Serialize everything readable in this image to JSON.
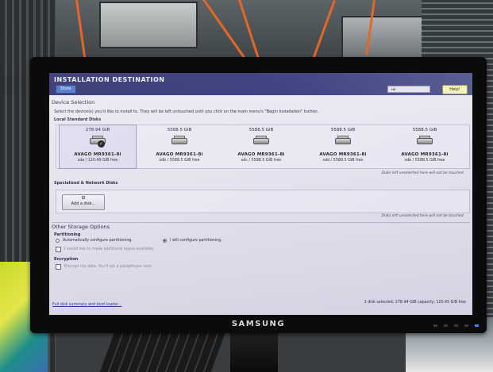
{
  "monitor": {
    "brand": "SAMSUNG"
  },
  "installer": {
    "title": "INSTALLATION DESTINATION",
    "done_label": "Done",
    "keyboard_value": "us",
    "help_label": "Help!",
    "device_selection": {
      "heading": "Device Selection",
      "description": "Select the device(s) you'd like to install to.  They will be left untouched until you click on the main menu's \"Begin Installation\" button.",
      "local_heading": "Local Standard Disks",
      "disks": [
        {
          "size": "278.94 GiB",
          "model": "AVAGO MR9361-8i",
          "detail": "sda  /  120.49 GiB free",
          "selected": true
        },
        {
          "size": "5588.5 GiB",
          "model": "AVAGO MR9361-8i",
          "detail": "sdb  /  5588.5 GiB free",
          "selected": false
        },
        {
          "size": "5588.5 GiB",
          "model": "AVAGO MR9361-8i",
          "detail": "sdc  /  5588.5 GiB free",
          "selected": false
        },
        {
          "size": "5588.5 GiB",
          "model": "AVAGO MR9361-8i",
          "detail": "sdd  /  5588.5 GiB free",
          "selected": false
        },
        {
          "size": "5588.5 GiB",
          "model": "AVAGO MR9361-8i",
          "detail": "sde  /  5588.5 GiB free",
          "selected": false
        }
      ],
      "local_note": "Disks left unselected here will not be touched.",
      "specialized_heading": "Specialized & Network Disks",
      "add_disk_label": "Add a disk...",
      "specialized_note": "Disks left unselected here will not be touched."
    },
    "storage_options": {
      "heading": "Other Storage Options",
      "partitioning_heading": "Partitioning",
      "auto_label": "Automatically configure partitioning.",
      "manual_label": "I will configure partitioning.",
      "additional_space_label": "I would like to make additional space available.",
      "encryption_heading": "Encryption",
      "encrypt_label": "Encrypt my data.  You'll set a passphrase next."
    },
    "footer": {
      "summary_link": "Full disk summary and boot loader...",
      "status": "1 disk selected; 278.94 GiB capacity; 120.45 GiB free"
    }
  }
}
